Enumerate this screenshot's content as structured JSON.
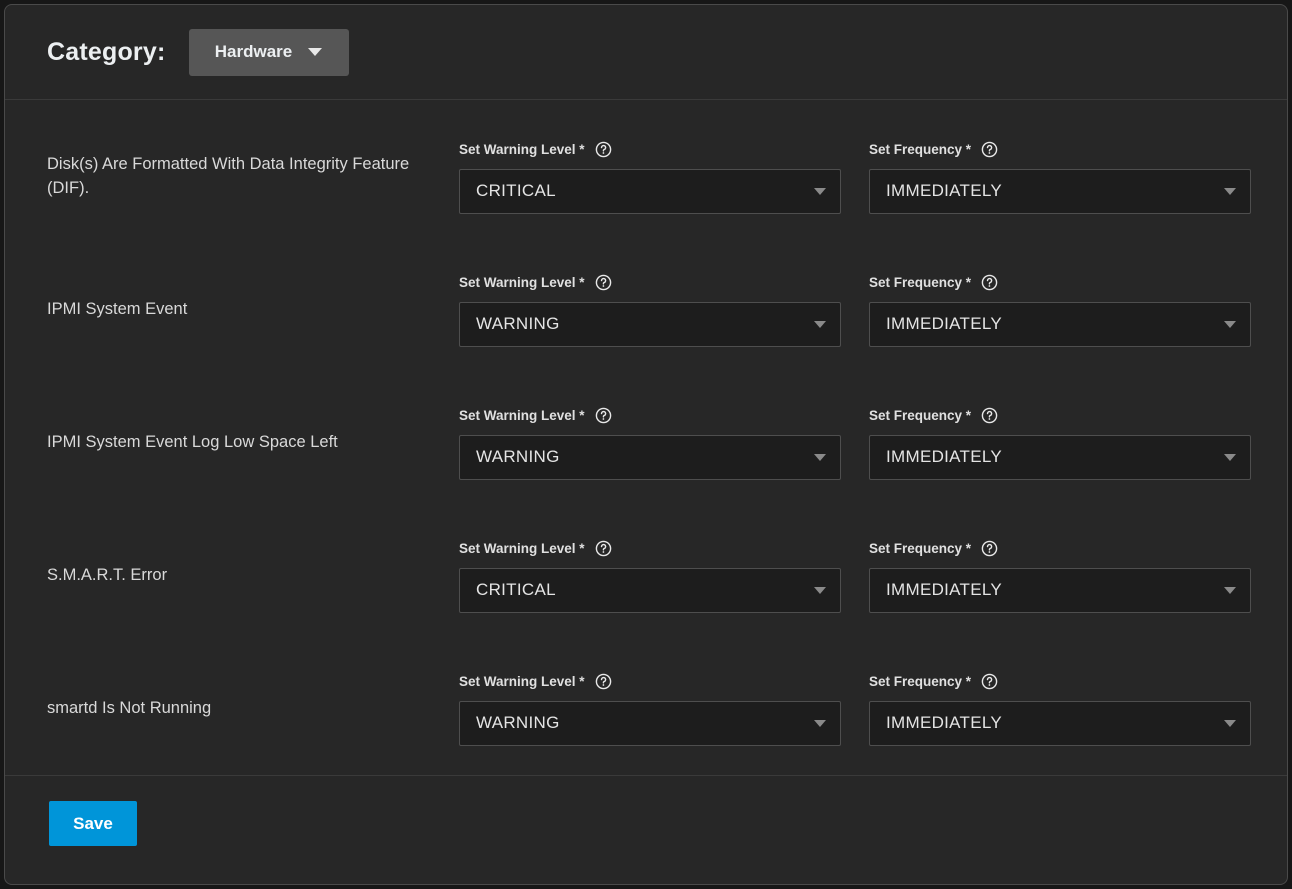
{
  "header": {
    "category_label": "Category:",
    "category_value": "Hardware",
    "dropdown_icon": "chevron-down-icon"
  },
  "field_labels": {
    "warning_level": "Set Warning Level *",
    "frequency": "Set Frequency *",
    "help_icon": "help-circle-icon"
  },
  "rows": [
    {
      "title": "Disk(s) Are Formatted With Data Integrity Feature (DIF).",
      "warning_level": "CRITICAL",
      "frequency": "IMMEDIATELY"
    },
    {
      "title": "IPMI System Event",
      "warning_level": "WARNING",
      "frequency": "IMMEDIATELY"
    },
    {
      "title": "IPMI System Event Log Low Space Left",
      "warning_level": "WARNING",
      "frequency": "IMMEDIATELY"
    },
    {
      "title": "S.M.A.R.T. Error",
      "warning_level": "CRITICAL",
      "frequency": "IMMEDIATELY"
    },
    {
      "title": "smartd Is Not Running",
      "warning_level": "WARNING",
      "frequency": "IMMEDIATELY"
    }
  ],
  "footer": {
    "save_label": "Save"
  },
  "colors": {
    "accent": "#0095d9",
    "panel_bg": "#272727",
    "page_bg": "#171717",
    "select_bg": "#1d1d1d",
    "dropdown_bg": "#565656"
  }
}
